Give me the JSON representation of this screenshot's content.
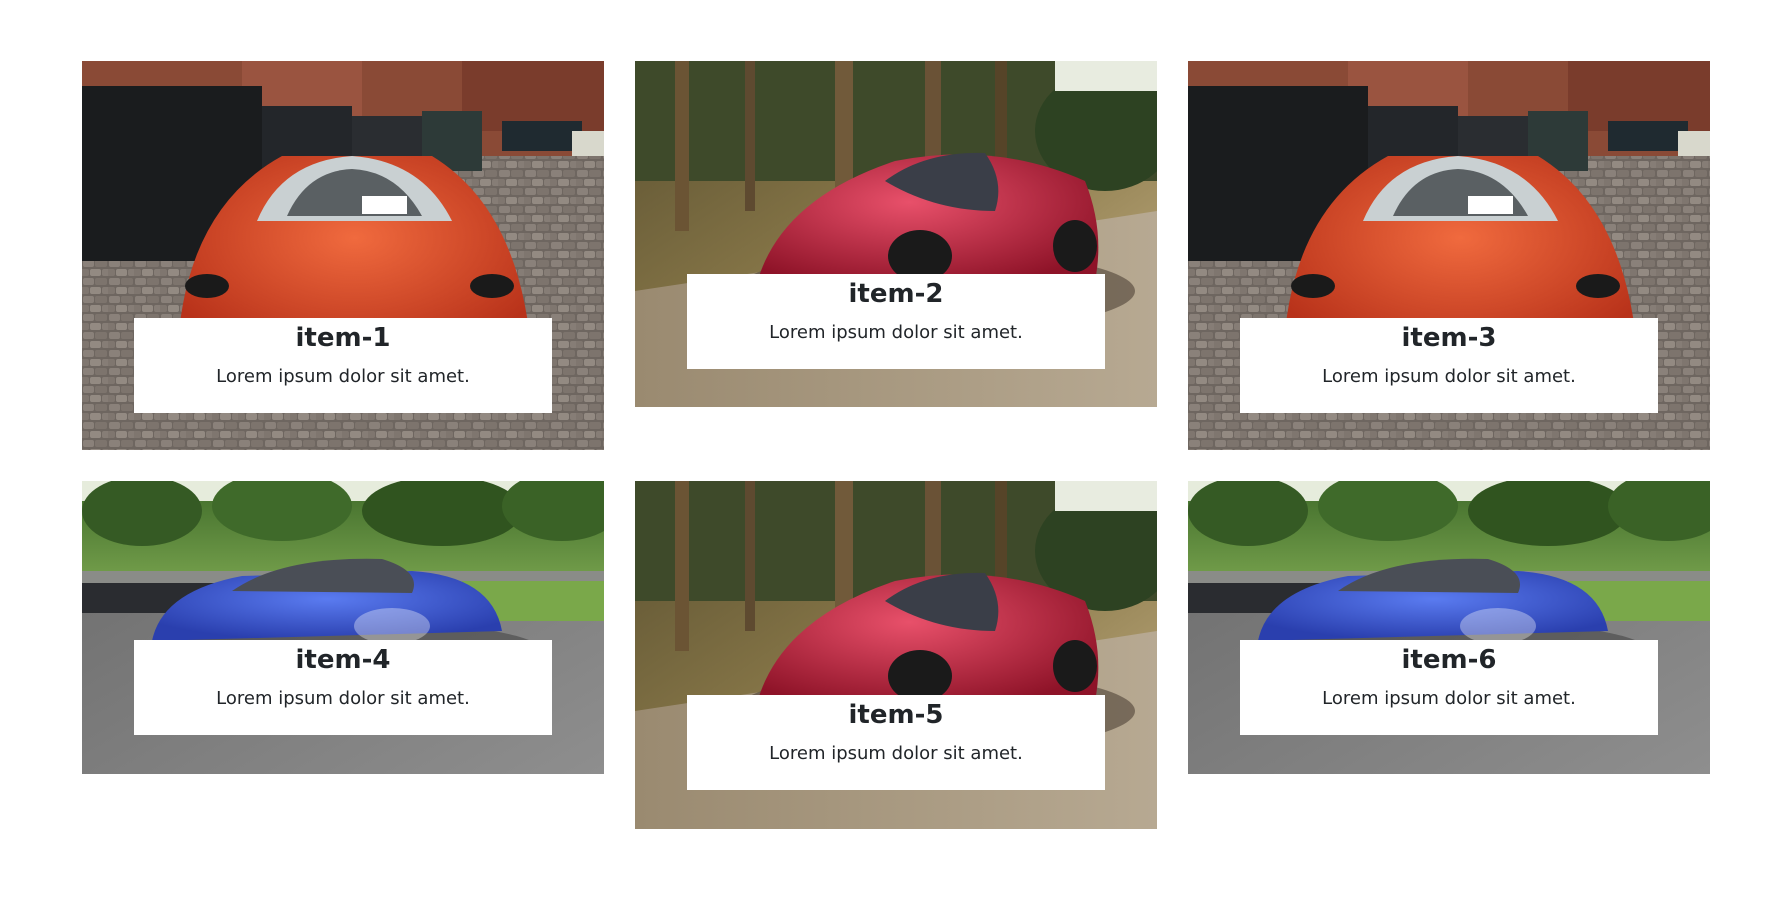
{
  "items": [
    {
      "title": "item-1",
      "text": "Lorem ipsum dolor sit amet.",
      "image": "red-sportscar-parking-lot"
    },
    {
      "title": "item-2",
      "text": "Lorem ipsum dolor sit amet.",
      "image": "red-sportscar-forest-road"
    },
    {
      "title": "item-3",
      "text": "Lorem ipsum dolor sit amet.",
      "image": "red-sportscar-parking-lot"
    },
    {
      "title": "item-4",
      "text": "Lorem ipsum dolor sit amet.",
      "image": "blue-sportscar-racetrack"
    },
    {
      "title": "item-5",
      "text": "Lorem ipsum dolor sit amet.",
      "image": "red-sportscar-forest-road"
    },
    {
      "title": "item-6",
      "text": "Lorem ipsum dolor sit amet.",
      "image": "blue-sportscar-racetrack"
    }
  ],
  "colors": {
    "background": "#ffffff",
    "caption_bg": "#ffffff",
    "text": "#212529"
  }
}
